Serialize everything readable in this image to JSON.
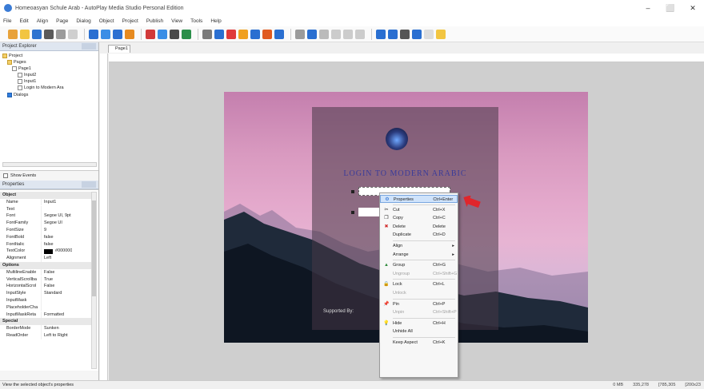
{
  "app": {
    "title": "Homeoasyan Schule Arab - AutoPlay Media Studio Personal Edition"
  },
  "window_controls": {
    "minimize": "–",
    "maximize": "⬜",
    "close": "✕"
  },
  "menu": [
    "File",
    "Edit",
    "Align",
    "Page",
    "Dialog",
    "Object",
    "Project",
    "Publish",
    "View",
    "Tools",
    "Help"
  ],
  "project_explorer": {
    "title": "Project Explorer",
    "tree": [
      {
        "label": "Project",
        "icon": "folder-icon"
      },
      {
        "label": "Pages",
        "icon": "folder-icon"
      },
      {
        "label": "Page1",
        "icon": "page-icon"
      },
      {
        "label": "Input2",
        "icon": "input-icon"
      },
      {
        "label": "Input1",
        "icon": "input-icon"
      },
      {
        "label": "Login to Modern Ara",
        "icon": "label-icon"
      },
      {
        "label": "Dialogs",
        "icon": "dialog-icon"
      }
    ],
    "show_events": "Show Events"
  },
  "properties": {
    "title": "Properties",
    "rows": [
      {
        "k": "Object",
        "v": "",
        "cat": true
      },
      {
        "k": "Name",
        "v": "Input1"
      },
      {
        "k": "Text",
        "v": ""
      },
      {
        "k": "Font",
        "v": "Segoe UI, 9pt"
      },
      {
        "k": "FontFamily",
        "v": "Segoe UI"
      },
      {
        "k": "FontSize",
        "v": "9"
      },
      {
        "k": "FontBold",
        "v": "false"
      },
      {
        "k": "FontItalic",
        "v": "false"
      },
      {
        "k": "TextColor",
        "v": "#000000",
        "swatch": true
      },
      {
        "k": "Alignment",
        "v": "Left"
      },
      {
        "k": "Options",
        "v": "",
        "cat": true
      },
      {
        "k": "MultilineEnable",
        "v": "False"
      },
      {
        "k": "VerticalScrollba",
        "v": "True"
      },
      {
        "k": "HorizontalScrol",
        "v": "False"
      },
      {
        "k": "InputStyle",
        "v": "Standard"
      },
      {
        "k": "InputMask",
        "v": ""
      },
      {
        "k": "PlaceholderCha",
        "v": ""
      },
      {
        "k": "InputMaskReta",
        "v": "Formatted"
      },
      {
        "k": "Special",
        "v": "",
        "cat": true
      },
      {
        "k": "BorderMode",
        "v": "Sunken"
      },
      {
        "k": "ReadOrder",
        "v": "Left to Right"
      }
    ]
  },
  "editor": {
    "tab": "Page1",
    "login_title": "LOGIN TO MODERN ARABIC",
    "supported_by": "Supported By:"
  },
  "context_menu": [
    {
      "label": "Properties",
      "shortcut": "Ctrl+Enter",
      "icon": "properties-icon",
      "highlight": true
    },
    {
      "sep": true
    },
    {
      "label": "Cut",
      "shortcut": "Ctrl+X",
      "icon": "cut-icon"
    },
    {
      "label": "Copy",
      "shortcut": "Ctrl+C",
      "icon": "copy-icon"
    },
    {
      "label": "Delete",
      "shortcut": "Delete",
      "icon": "delete-icon"
    },
    {
      "label": "Duplicate",
      "shortcut": "Ctrl+D",
      "icon": ""
    },
    {
      "sep": true
    },
    {
      "label": "Align",
      "shortcut": "",
      "icon": "",
      "submenu": true
    },
    {
      "label": "Arrange",
      "shortcut": "",
      "icon": "",
      "submenu": true
    },
    {
      "sep": true
    },
    {
      "label": "Group",
      "shortcut": "Ctrl+G",
      "icon": "group-icon"
    },
    {
      "label": "Ungroup",
      "shortcut": "Ctrl+Shift+G",
      "icon": "",
      "disabled": true
    },
    {
      "sep": true
    },
    {
      "label": "Lock",
      "shortcut": "Ctrl+L",
      "icon": "lock-icon"
    },
    {
      "label": "Unlock",
      "shortcut": "",
      "icon": "",
      "disabled": true
    },
    {
      "sep": true
    },
    {
      "label": "Pin",
      "shortcut": "Ctrl+P",
      "icon": "pin-icon"
    },
    {
      "label": "Unpin",
      "shortcut": "Ctrl+Shift+P",
      "icon": "",
      "disabled": true
    },
    {
      "sep": true
    },
    {
      "label": "Hide",
      "shortcut": "Ctrl+H",
      "icon": "hide-icon"
    },
    {
      "label": "Unhide All",
      "shortcut": "",
      "icon": ""
    },
    {
      "sep": true
    },
    {
      "label": "Keep Aspect",
      "shortcut": "Ctrl+K",
      "icon": ""
    }
  ],
  "status": {
    "left": "View the selected object's properties",
    "memory": "0 MB",
    "pos": "335,278",
    "size": "[785,305",
    "dims": "[200x23"
  },
  "colors": {
    "accent": "#3a3b9a",
    "highlight": "#cfe3fb",
    "arrow": "#e0262b"
  }
}
